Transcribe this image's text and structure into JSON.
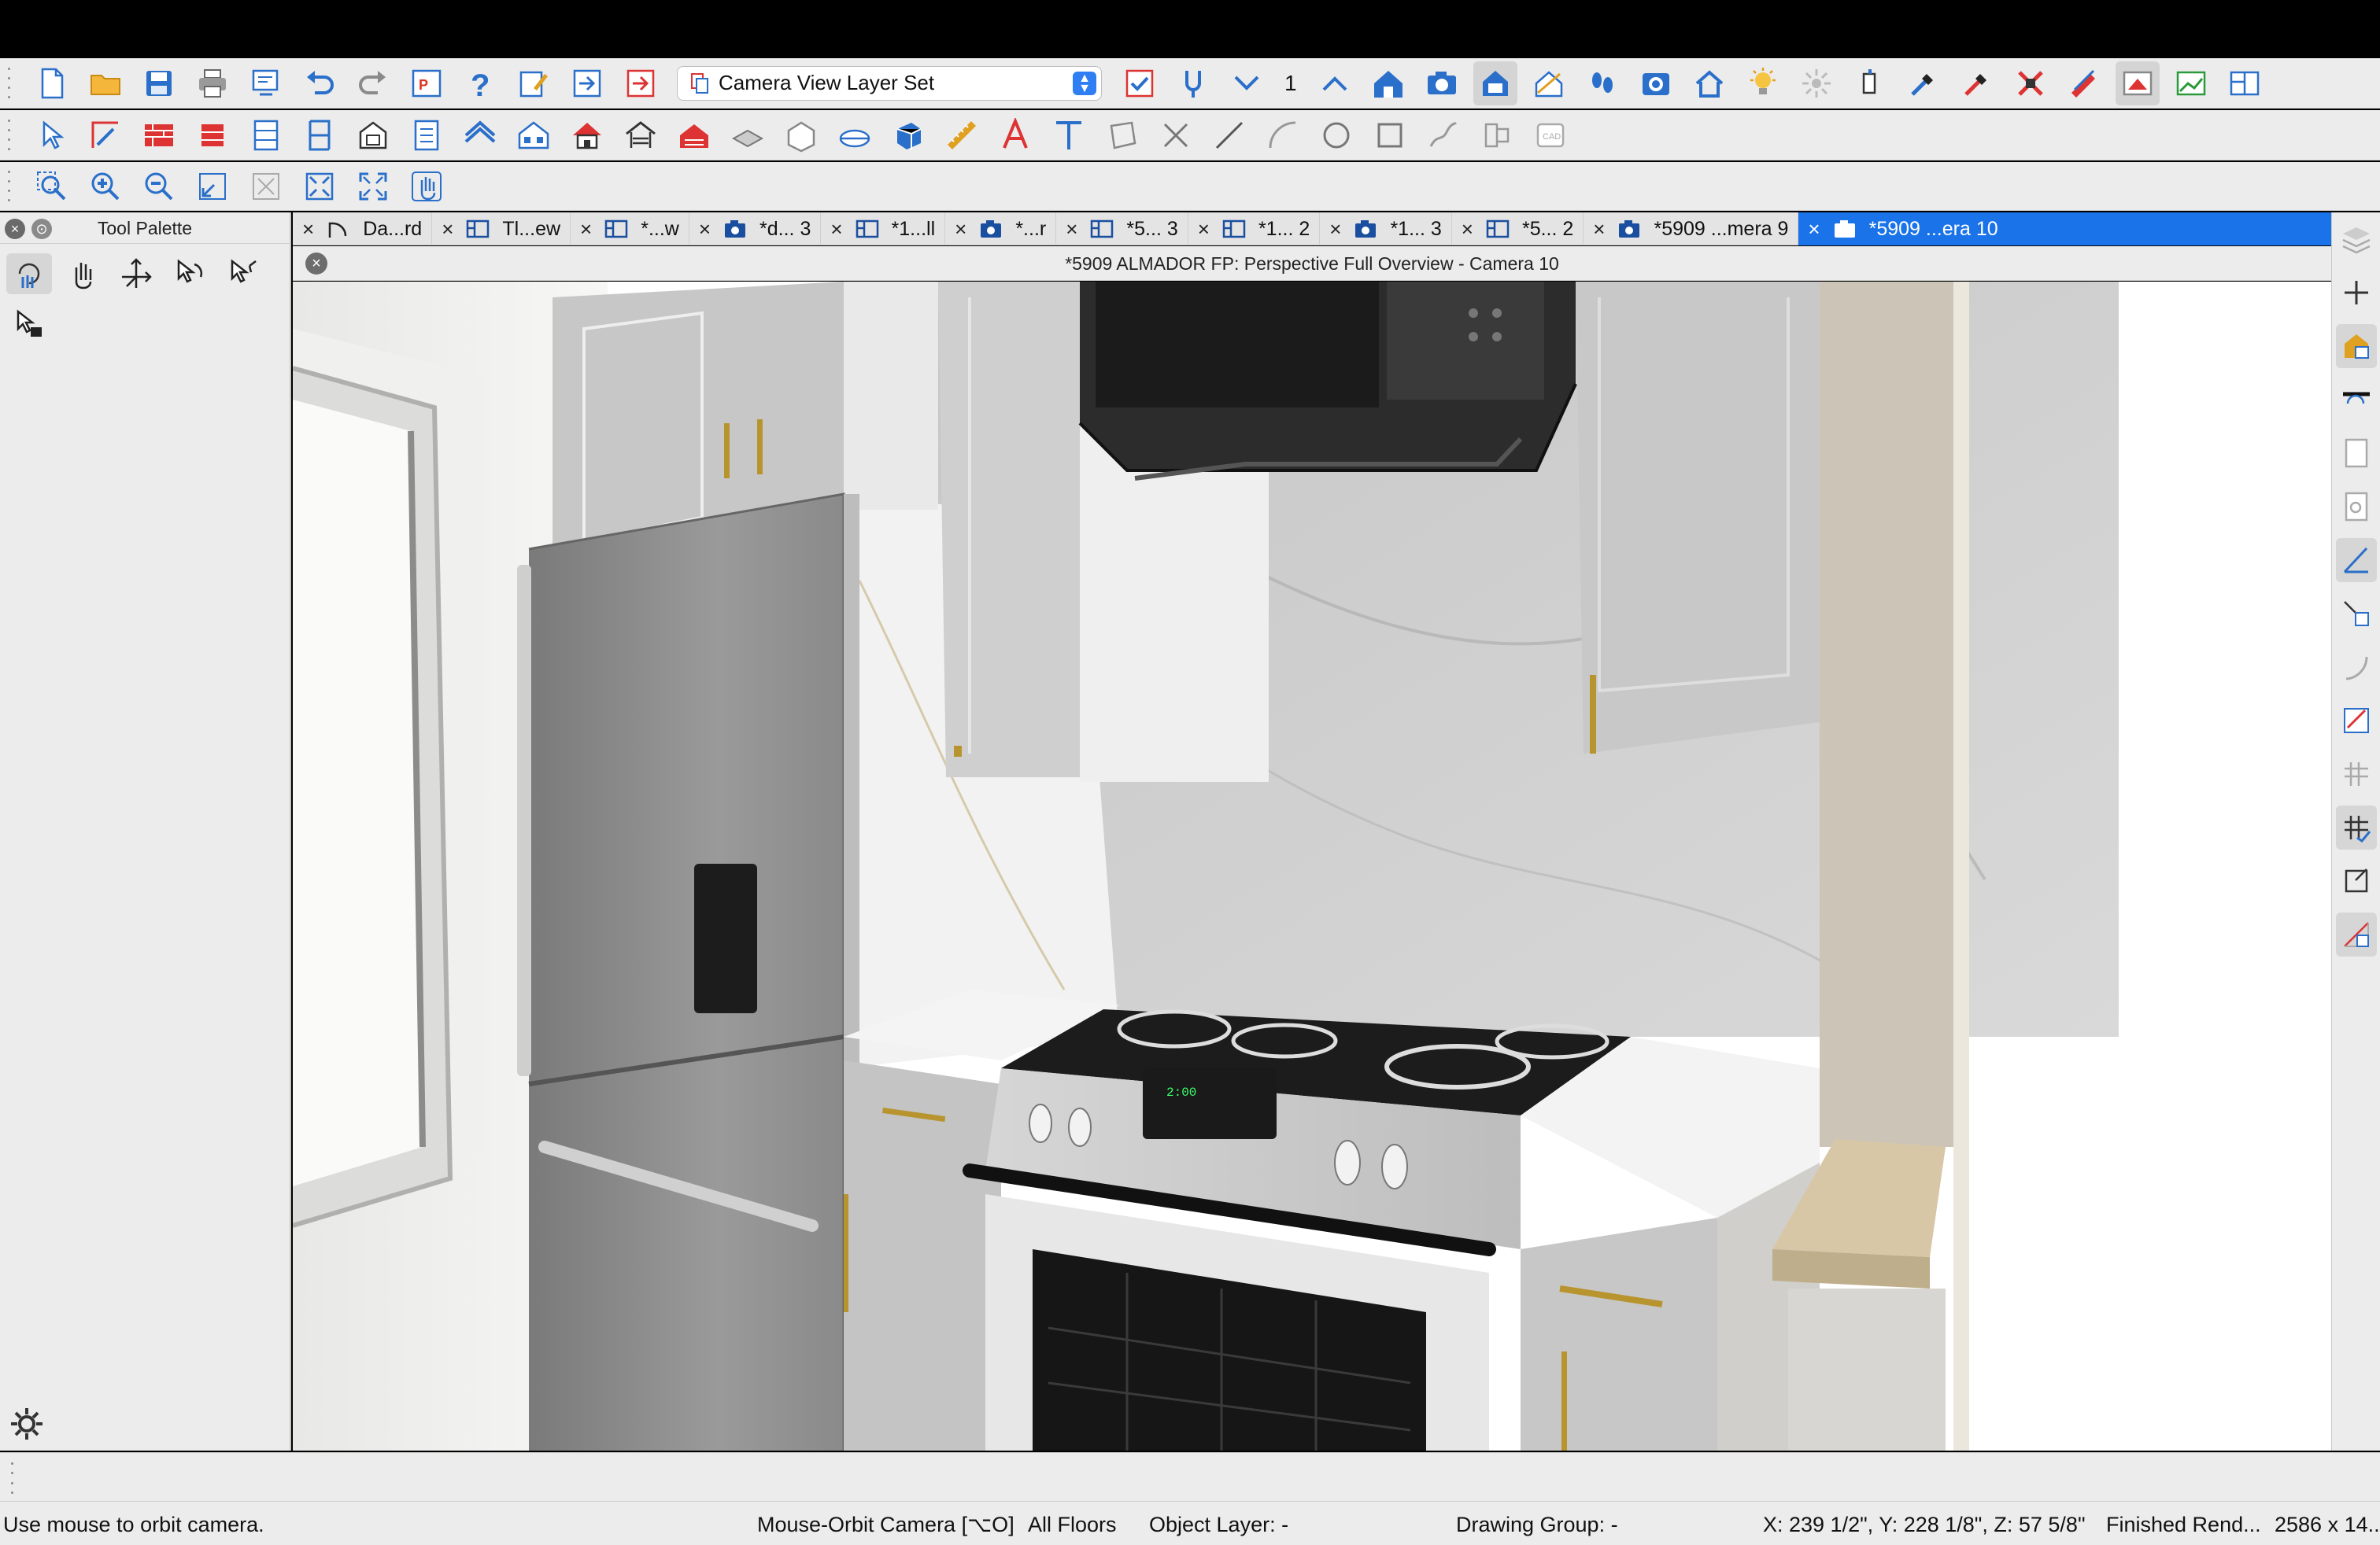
{
  "toolbar": {
    "layer_set": "Camera View Layer Set",
    "floor_number": "1",
    "icons_row1": [
      "new-file",
      "open-folder",
      "save",
      "print",
      "print-preview",
      "undo",
      "redo",
      "plan-check",
      "help",
      "edit-layout",
      "send-to-layout",
      "send-to-layout-red",
      "layer-set-dropdown",
      "display-options",
      "tape-measure",
      "floor-down",
      "floor-up",
      "camera-house",
      "camera",
      "camera-dollhouse",
      "cross-section",
      "walkthrough",
      "render-camera",
      "full-overview",
      "light",
      "sun-angle",
      "spotlight",
      "pick-material",
      "material-eyedropper",
      "delete-materials",
      "red-pencil",
      "plan-view",
      "elevation-view",
      "tile-windows"
    ],
    "icons_row2": [
      "select",
      "edit-area",
      "wall",
      "railing",
      "cabinet",
      "door",
      "window",
      "stairs",
      "roof",
      "building",
      "house-red",
      "garage",
      "fence",
      "room",
      "slab",
      "terrain",
      "polyline-solid",
      "cube",
      "dimension",
      "text-style",
      "text",
      "cad-shape",
      "delete",
      "line",
      "arc",
      "circle",
      "rectangle",
      "spline",
      "break-line",
      "cad-block"
    ],
    "icons_row3": [
      "zoom-window",
      "zoom-in",
      "zoom-out",
      "undo-zoom",
      "fill-window",
      "fill-window-all",
      "full-screen",
      "pan"
    ]
  },
  "palette": {
    "title": "Tool Palette",
    "tools": [
      "orbit-camera-tool",
      "pan-camera-tool",
      "move-camera-tool",
      "rotate-camera-tool",
      "tilt-camera-tool",
      "select-camera-tool"
    ]
  },
  "tabs": [
    {
      "label": "Da...rd",
      "icon": "cad-arc-icon"
    },
    {
      "label": "Tl...ew",
      "icon": "layout-icon"
    },
    {
      "label": "*...w",
      "icon": "layout-icon"
    },
    {
      "label": "*d... 3",
      "icon": "camera-tab-icon"
    },
    {
      "label": "*1...ll",
      "icon": "layout-icon"
    },
    {
      "label": "*...r",
      "icon": "camera-tab-icon"
    },
    {
      "label": "*5... 3",
      "icon": "layout-icon"
    },
    {
      "label": "*1... 2",
      "icon": "layout-icon"
    },
    {
      "label": "*1... 3",
      "icon": "camera-tab-icon"
    },
    {
      "label": "*5... 2",
      "icon": "layout-icon"
    },
    {
      "label": "*5909 ...mera 9",
      "icon": "camera-tab-icon"
    },
    {
      "label": "*5909 ...era 10",
      "icon": "camera-tab-icon",
      "active": true
    }
  ],
  "window_title": "*5909 ALMADOR FP: Perspective Full Overview - Camera 10",
  "statusbar": {
    "hint": "Use mouse to orbit camera.",
    "mode": "Mouse-Orbit Camera [⌥O]",
    "floors": "All Floors",
    "object_layer": "Object Layer: -",
    "drawing_group": "Drawing Group: -",
    "coordinates": "X: 239 1/2\", Y: 228 1/8\", Z: 57 5/8\"",
    "render_status": "Finished Rend...",
    "resolution": "2586 x 14..."
  },
  "colors": {
    "accent": "#1a73e8",
    "cabinet": "#c9c9c9",
    "fridge": "#8e8e8e",
    "countertop": "#f4f4f4",
    "range_top": "#1c1c1c",
    "brass": "#b8942e"
  },
  "rightbar": [
    "layers-icon",
    "add-icon",
    "object-layer-icon",
    "line-style-icon",
    "page-icon",
    "doc-search-icon",
    "angle-snap-icon",
    "object-snap-icon",
    "arc-snap-icon",
    "dimension-check-icon",
    "grid-icon",
    "grid-snap-icon",
    "bounding-box-icon",
    "slope-icon"
  ]
}
